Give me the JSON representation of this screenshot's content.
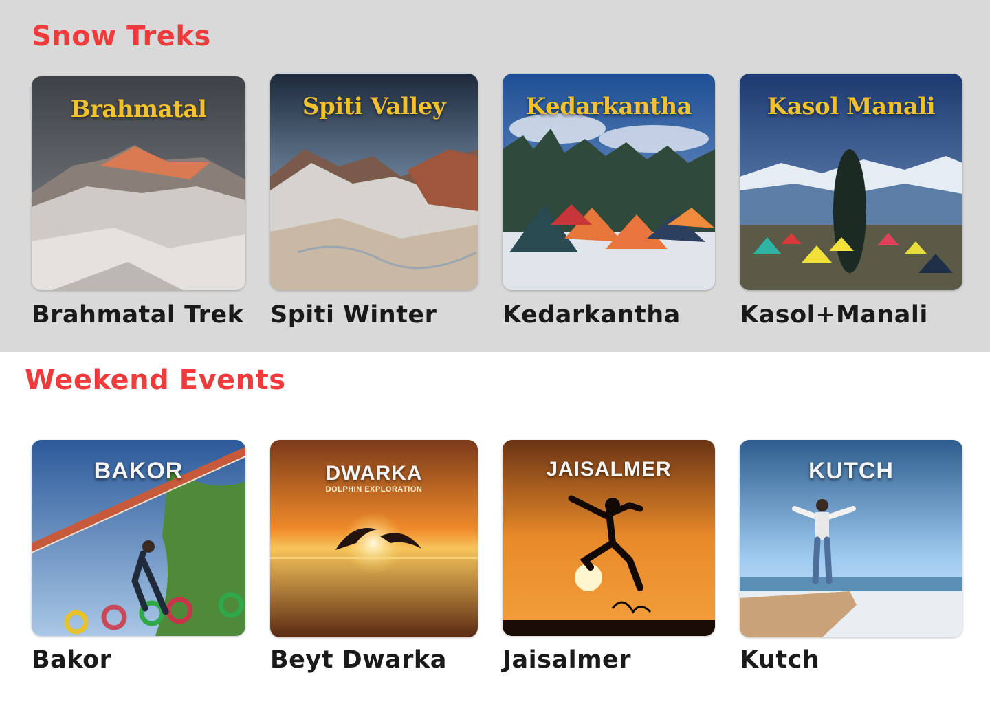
{
  "snow_treks": {
    "title": "Snow Treks",
    "cards": [
      {
        "image_title": "Brahmatal",
        "label": "Brahmatal Trek"
      },
      {
        "image_title": "Spiti Valley",
        "label": "Spiti Winter"
      },
      {
        "image_title": "Kedarkantha",
        "label": "Kedarkantha"
      },
      {
        "image_title": "Kasol Manali",
        "label": "Kasol+Manali"
      }
    ]
  },
  "weekend_events": {
    "title": "Weekend Events",
    "cards": [
      {
        "image_title": "BAKOR",
        "label": "Bakor"
      },
      {
        "image_title": "DWARKA",
        "image_subtitle": "DOLPHIN EXPLORATION",
        "label": "Beyt Dwarka"
      },
      {
        "image_title": "JAISALMER",
        "label": "Jaisalmer"
      },
      {
        "image_title": "KUTCH",
        "label": "Kutch"
      }
    ]
  },
  "colors": {
    "section_title": "#ef3b3b",
    "grey_band": "#d9d9d9",
    "label_text": "#1a1a1a"
  }
}
